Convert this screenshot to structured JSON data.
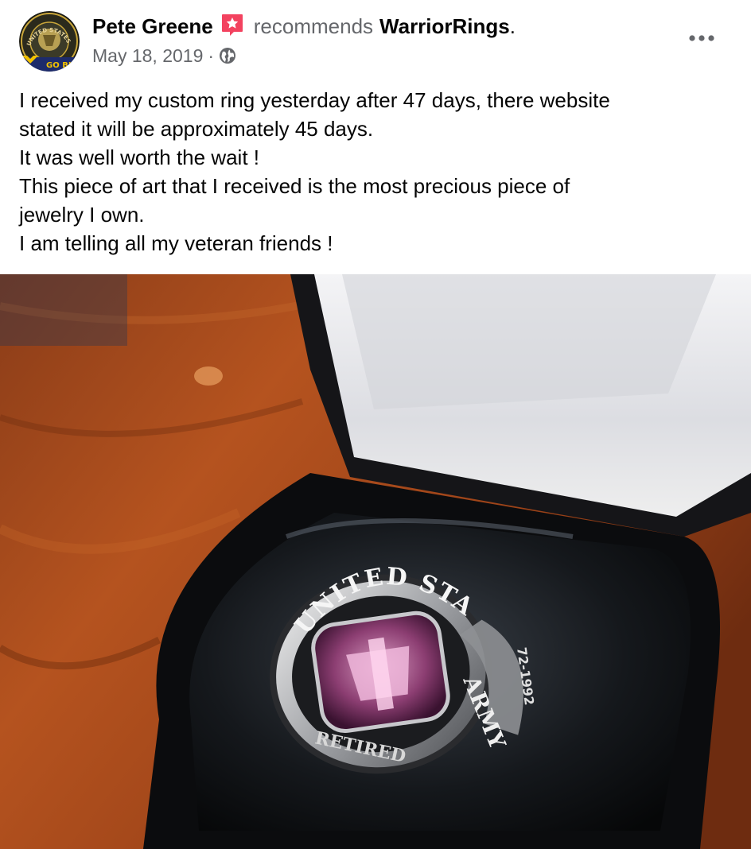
{
  "post": {
    "author": "Pete Greene",
    "verb": "recommends",
    "page": "WarriorRings",
    "period": ".",
    "date": "May 18, 2019",
    "separator": "·",
    "privacy_icon": "globe-icon",
    "badge_icon": "recommendation-star-icon",
    "more_icon": "more-options-icon",
    "text_lines": [
      "I received my custom ring yesterday after 47 days, there website",
      "stated it will be approximately 45 days.",
      "It was well worth the wait !",
      "This piece of art that I received is the most precious piece of",
      "jewelry I own.",
      "I am telling all my veteran friends !"
    ]
  },
  "avatar": {
    "arc_text": "UNITED STATES ARMY",
    "banner_text": "GO BLUE"
  },
  "photo": {
    "ring_top_text": "UNITED STATES",
    "ring_side_text": "ARMY",
    "ring_bottom_text": "RETIRED",
    "ring_year_text": "72-1992"
  },
  "colors": {
    "recommend_badge": "#f3425f",
    "secondary_text": "#65676b",
    "primary_text": "#050505"
  }
}
